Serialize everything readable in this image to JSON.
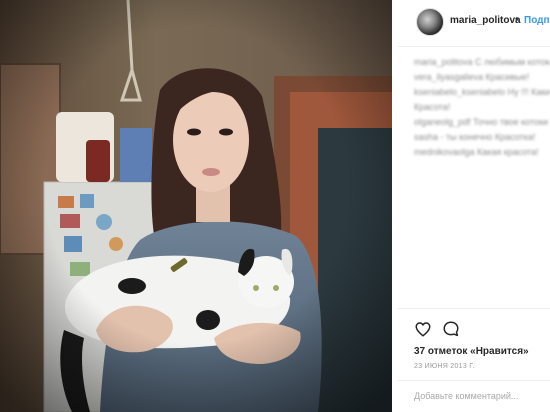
{
  "post": {
    "username": "maria_politova",
    "separator": "•",
    "follow_label": "Подпи",
    "likes_text": "37 отметок «Нравится»",
    "date_text": "23 ИЮНЯ 2013 Г.",
    "comment_placeholder": "Добавьте комментарий..."
  },
  "comments": [
    {
      "text": "maria_politova С любимым котом #cat #love"
    },
    {
      "text": "vera_ilyasgalieva Красивые!"
    },
    {
      "text": "kseniabelo_kseniabelo Ну !!! Какие красивые"
    },
    {
      "text": "Красота!"
    },
    {
      "text": "olganeolg_pdf Точно твое котоки"
    },
    {
      "text": "sasha - ты конечно Красотка!"
    },
    {
      "text": "mednikovaolga Какая красота!"
    }
  ],
  "icons": {
    "like": "heart-outline-icon",
    "comment": "speech-bubble-icon"
  },
  "colors": {
    "link": "#3897f0",
    "text": "#262626",
    "muted": "#999999"
  }
}
